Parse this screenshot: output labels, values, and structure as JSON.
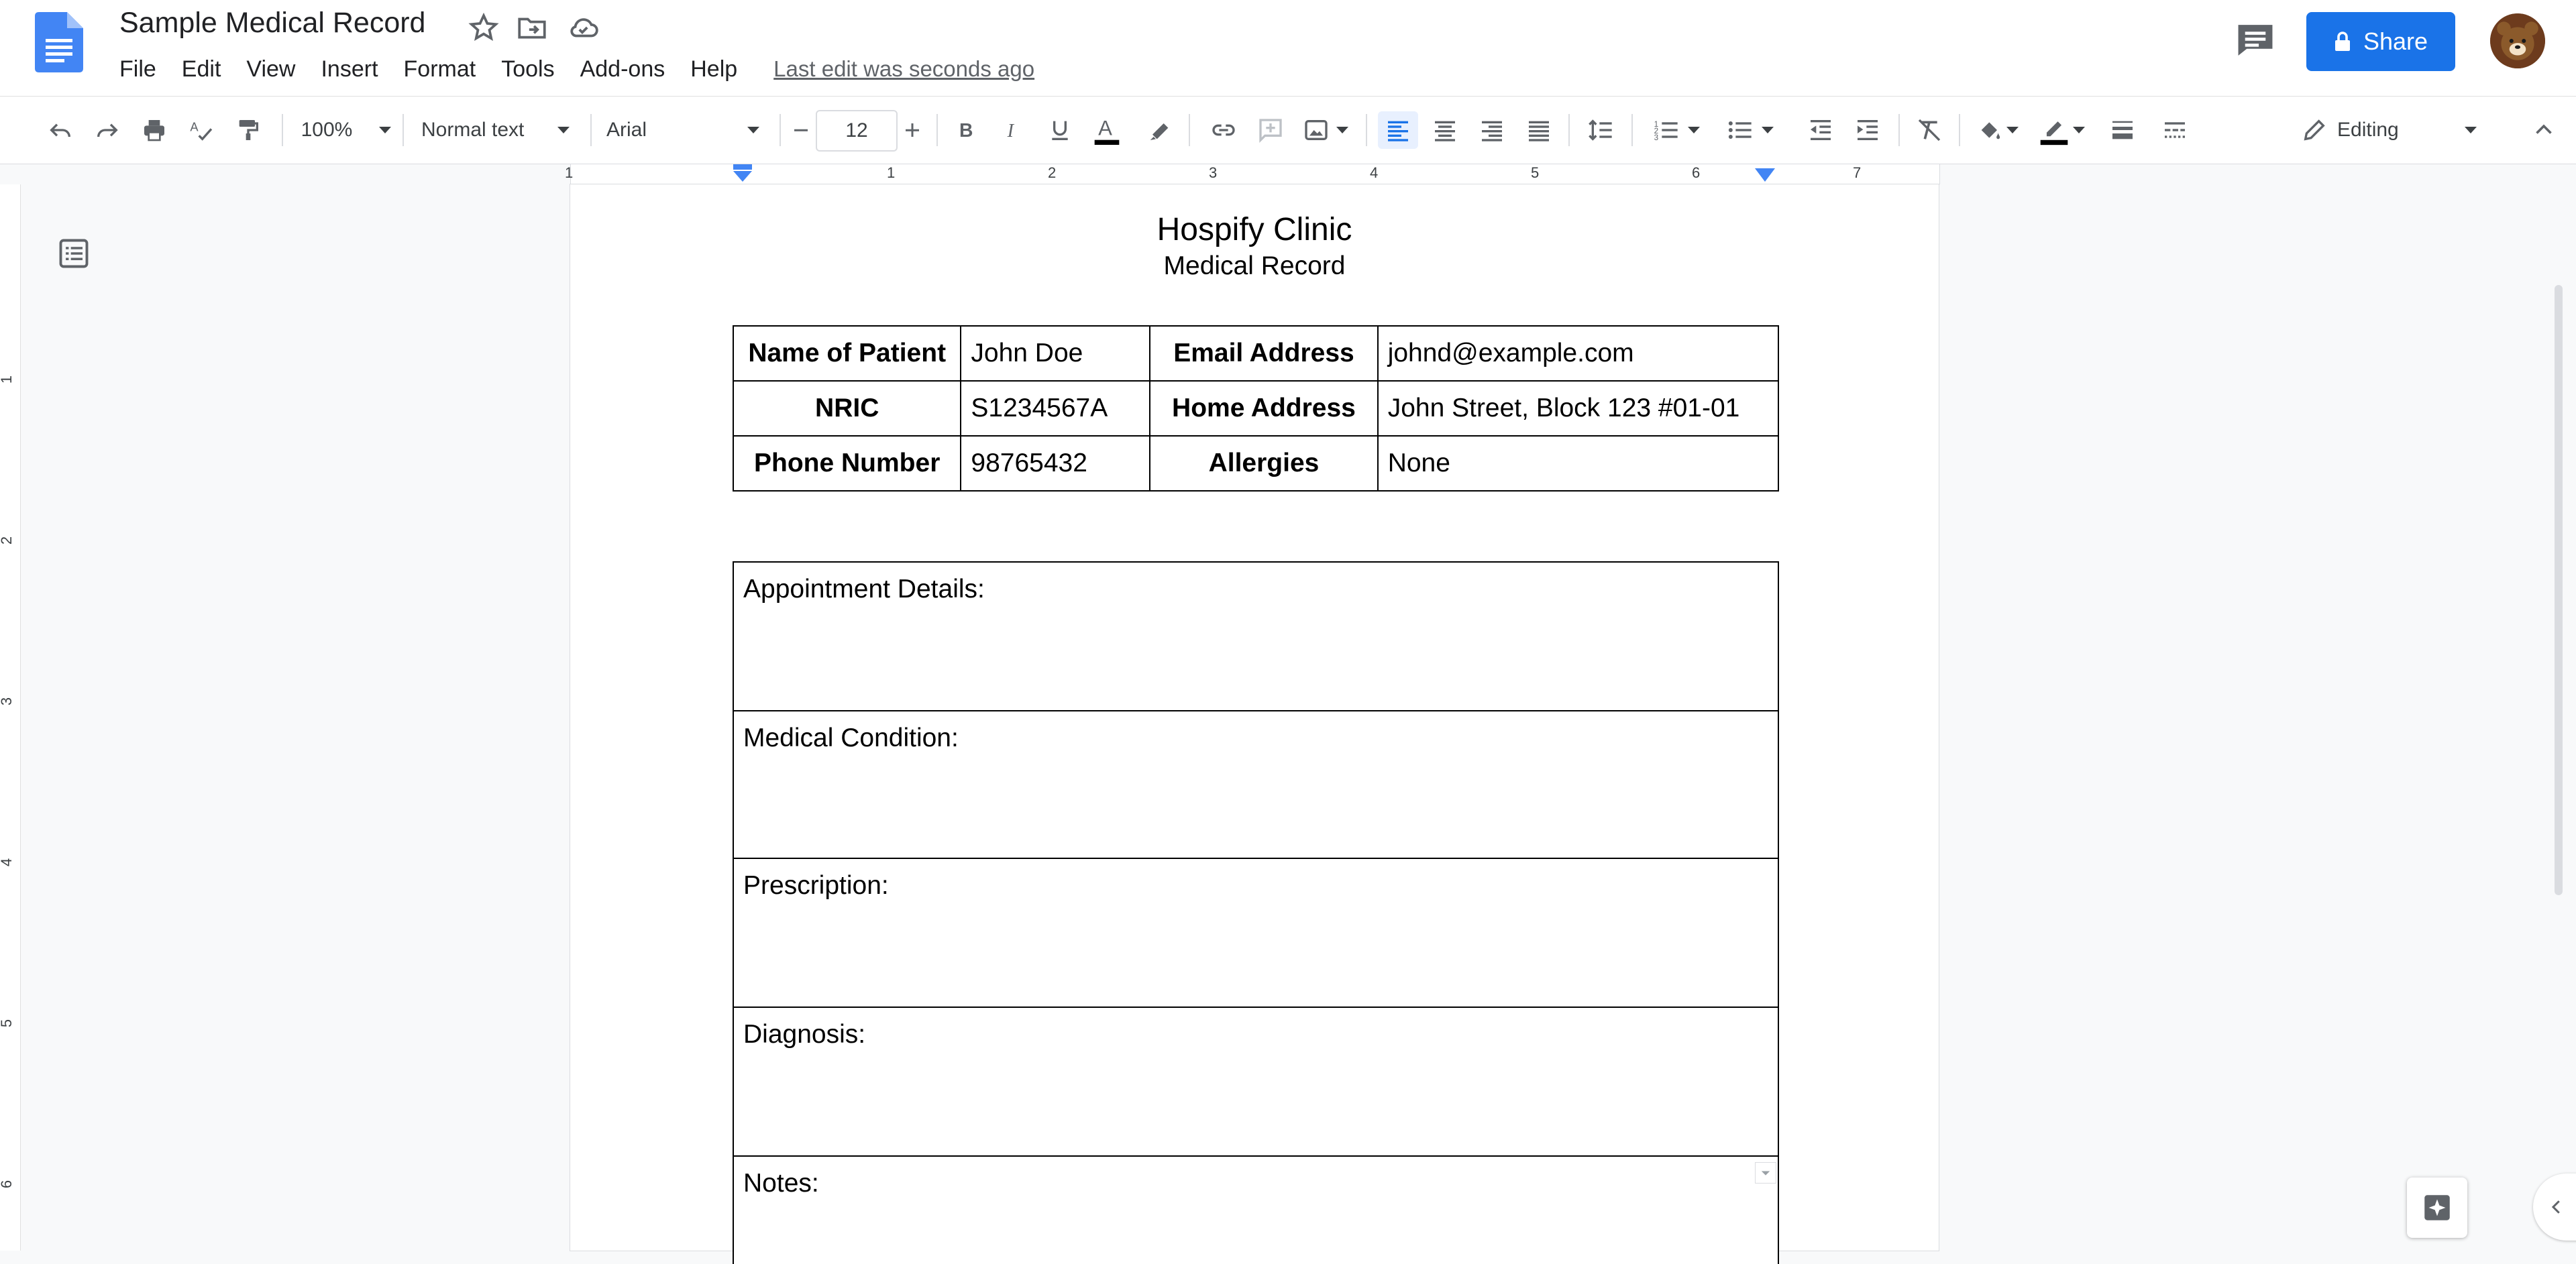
{
  "header": {
    "doc_title": "Sample Medical Record",
    "menu": [
      "File",
      "Edit",
      "View",
      "Insert",
      "Format",
      "Tools",
      "Add-ons",
      "Help"
    ],
    "last_edit": "Last edit was seconds ago",
    "share_label": "Share",
    "icons": [
      "docs-logo-icon",
      "star-icon",
      "move-folder-icon",
      "cloud-saved-icon",
      "comments-icon",
      "lock-icon"
    ]
  },
  "toolbar": {
    "zoom": "100%",
    "style": "Normal text",
    "font": "Arial",
    "font_size": "12",
    "mode": "Editing",
    "colors": {
      "text_color": "#000000",
      "accent": "#1a73e8"
    }
  },
  "ruler": {
    "h_numbers": [
      "1",
      "1",
      "2",
      "3",
      "4",
      "5",
      "6",
      "7"
    ],
    "v_numbers": [
      "1",
      "2",
      "3",
      "4",
      "5",
      "6"
    ]
  },
  "document": {
    "clinic_name": "Hospify Clinic",
    "subtitle": "Medical Record",
    "info_rows": [
      {
        "label1": "Name of Patient",
        "value1": "John Doe",
        "label2": "Email Address",
        "value2": "johnd@example.com"
      },
      {
        "label1": "NRIC",
        "value1": "S1234567A",
        "label2": "Home Address",
        "value2": "John Street, Block 123 #01-01"
      },
      {
        "label1": "Phone Number",
        "value1": "98765432",
        "label2": "Allergies",
        "value2": "None"
      }
    ],
    "sections": [
      "Appointment Details:",
      "Medical Condition:",
      "Prescription:",
      "Diagnosis:",
      "Notes:"
    ]
  }
}
